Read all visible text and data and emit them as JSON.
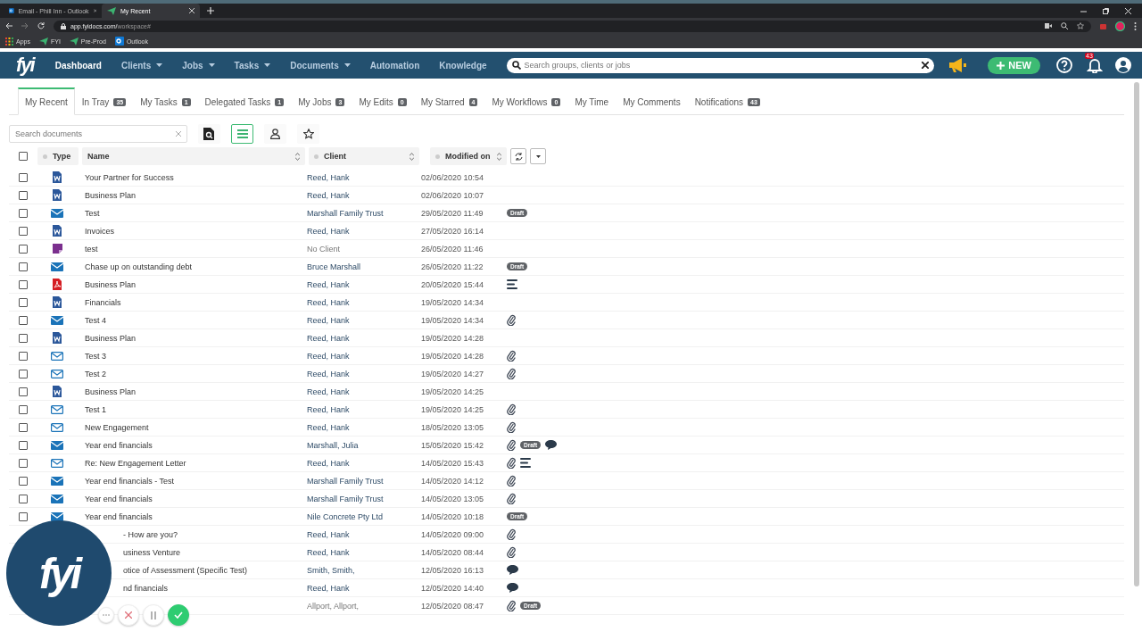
{
  "browser": {
    "tabs": [
      {
        "title": "Email - Phill Inn - Outlook",
        "selected": false,
        "kind": "outlook"
      },
      {
        "title": "My Recent",
        "selected": true,
        "kind": "fyi"
      }
    ],
    "url_host": "app.fyidocs.com/",
    "url_path": "workspace#",
    "bookmarks": [
      {
        "label": "Apps",
        "kind": "apps"
      },
      {
        "label": "FYI",
        "kind": "fyi"
      },
      {
        "label": "Pre-Prod",
        "kind": "fyi"
      },
      {
        "label": "Outlook",
        "kind": "outlook"
      }
    ]
  },
  "app": {
    "logo": "fyi",
    "nav": [
      {
        "label": "Dashboard",
        "selected": true,
        "dropdown": false
      },
      {
        "label": "Clients",
        "selected": false,
        "dropdown": true
      },
      {
        "label": "Jobs",
        "selected": false,
        "dropdown": true
      },
      {
        "label": "Tasks",
        "selected": false,
        "dropdown": true
      },
      {
        "label": "Documents",
        "selected": false,
        "dropdown": true
      },
      {
        "label": "Automation",
        "selected": false,
        "dropdown": false
      },
      {
        "label": "Knowledge",
        "selected": false,
        "dropdown": false
      }
    ],
    "search": {
      "placeholder": "Search groups, clients or jobs"
    },
    "new_button": "NEW",
    "notification_count": "43"
  },
  "tabs": [
    {
      "label": "My Recent",
      "selected": true
    },
    {
      "label": "In Tray",
      "count": "35",
      "selected": false
    },
    {
      "label": "My Tasks",
      "count": "1",
      "selected": false
    },
    {
      "label": "Delegated Tasks",
      "count": "1",
      "selected": false
    },
    {
      "label": "My Jobs",
      "count": "3",
      "selected": false
    },
    {
      "label": "My Edits",
      "count": "0",
      "selected": false
    },
    {
      "label": "My Starred",
      "count": "4",
      "selected": false
    },
    {
      "label": "My Workflows",
      "count": "0",
      "selected": false
    },
    {
      "label": "My Time",
      "selected": false
    },
    {
      "label": "My Comments",
      "selected": false
    },
    {
      "label": "Notifications",
      "count": "43",
      "selected": false
    }
  ],
  "toolbar": {
    "search_placeholder": "Search documents",
    "views": [
      {
        "kind": "preview",
        "selected": false
      },
      {
        "kind": "list",
        "selected": true
      },
      {
        "kind": "person",
        "selected": false
      },
      {
        "kind": "star",
        "selected": false
      }
    ]
  },
  "table": {
    "select_all_checked": false,
    "columns": [
      "Type",
      "Name",
      "Client",
      "Modified on"
    ],
    "rows": [
      {
        "kind": "word",
        "checked": false,
        "name": "Your Partner for Success",
        "client": "Reed, Hank",
        "linked": true,
        "modified": "02/06/2020 10:54",
        "marks": []
      },
      {
        "kind": "word",
        "checked": false,
        "name": "Business Plan",
        "client": "Reed, Hank",
        "linked": true,
        "modified": "02/06/2020 10:07",
        "marks": []
      },
      {
        "kind": "email",
        "checked": false,
        "name": "Test",
        "client": "Marshall Family Trust",
        "linked": true,
        "modified": "29/05/2020 11:49",
        "marks": [
          {
            "kind": "badge",
            "label": "Draft"
          }
        ]
      },
      {
        "kind": "word",
        "checked": false,
        "name": "Invoices",
        "client": "Reed, Hank",
        "linked": true,
        "modified": "27/05/2020 16:14",
        "marks": []
      },
      {
        "kind": "note",
        "checked": false,
        "name": "test",
        "client": "No Client",
        "linked": false,
        "modified": "26/05/2020 11:46",
        "marks": []
      },
      {
        "kind": "email",
        "checked": false,
        "name": "Chase up on outstanding debt",
        "client": "Bruce Marshall",
        "linked": true,
        "modified": "26/05/2020 11:22",
        "marks": [
          {
            "kind": "badge",
            "label": "Draft"
          }
        ]
      },
      {
        "kind": "pdf",
        "checked": false,
        "name": "Business Plan",
        "client": "Reed, Hank",
        "linked": true,
        "modified": "20/05/2020 15:44",
        "marks": [
          {
            "kind": "notes"
          }
        ]
      },
      {
        "kind": "word",
        "checked": false,
        "name": "Financials",
        "client": "Reed, Hank",
        "linked": true,
        "modified": "19/05/2020 14:34",
        "marks": []
      },
      {
        "kind": "email",
        "checked": false,
        "name": "Test 4",
        "client": "Reed, Hank",
        "linked": true,
        "modified": "19/05/2020 14:34",
        "marks": [
          {
            "kind": "attachment"
          }
        ]
      },
      {
        "kind": "word",
        "checked": false,
        "name": "Business Plan",
        "client": "Reed, Hank",
        "linked": true,
        "modified": "19/05/2020 14:28",
        "marks": []
      },
      {
        "kind": "email-outline",
        "checked": false,
        "name": "Test 3",
        "client": "Reed, Hank",
        "linked": true,
        "modified": "19/05/2020 14:28",
        "marks": [
          {
            "kind": "attachment"
          }
        ]
      },
      {
        "kind": "email-outline",
        "checked": false,
        "name": "Test 2",
        "client": "Reed, Hank",
        "linked": true,
        "modified": "19/05/2020 14:27",
        "marks": [
          {
            "kind": "attachment"
          }
        ]
      },
      {
        "kind": "word",
        "checked": false,
        "name": "Business Plan",
        "client": "Reed, Hank",
        "linked": true,
        "modified": "19/05/2020 14:25",
        "marks": []
      },
      {
        "kind": "email-outline",
        "checked": false,
        "name": "Test 1",
        "client": "Reed, Hank",
        "linked": true,
        "modified": "19/05/2020 14:25",
        "marks": [
          {
            "kind": "attachment"
          }
        ]
      },
      {
        "kind": "email-outline",
        "checked": false,
        "name": "New Engagement",
        "client": "Reed, Hank",
        "linked": true,
        "modified": "18/05/2020 13:05",
        "marks": [
          {
            "kind": "attachment"
          }
        ]
      },
      {
        "kind": "email",
        "checked": false,
        "name": "Year end financials",
        "client": "Marshall, Julia",
        "linked": true,
        "modified": "15/05/2020 15:42",
        "marks": [
          {
            "kind": "attachment"
          },
          {
            "kind": "badge",
            "label": "Draft"
          },
          {
            "kind": "comment"
          }
        ]
      },
      {
        "kind": "email-outline",
        "checked": false,
        "name": "Re: New Engagement Letter",
        "client": "Reed, Hank",
        "linked": true,
        "modified": "14/05/2020 15:43",
        "marks": [
          {
            "kind": "attachment"
          },
          {
            "kind": "notes"
          }
        ]
      },
      {
        "kind": "email",
        "checked": false,
        "name": "Year end financials - Test",
        "client": "Marshall Family Trust",
        "linked": true,
        "modified": "14/05/2020 14:12",
        "marks": [
          {
            "kind": "attachment"
          }
        ]
      },
      {
        "kind": "email",
        "checked": false,
        "name": "Year end financials",
        "client": "Marshall Family Trust",
        "linked": true,
        "modified": "14/05/2020 13:05",
        "marks": [
          {
            "kind": "attachment"
          }
        ]
      },
      {
        "kind": "email",
        "checked": false,
        "name": "Year end financials",
        "client": "Nile Concrete Pty Ltd",
        "linked": true,
        "modified": "14/05/2020 10:18",
        "marks": [
          {
            "kind": "badge",
            "label": "Draft"
          }
        ]
      },
      {
        "name": "- How are you?",
        "client": "Reed, Hank",
        "linked": true,
        "modified": "14/05/2020 09:00",
        "marks": [
          {
            "kind": "attachment"
          }
        ]
      },
      {
        "name": "usiness Venture",
        "client": "Reed, Hank",
        "linked": true,
        "modified": "14/05/2020 08:44",
        "marks": [
          {
            "kind": "attachment"
          }
        ]
      },
      {
        "name": "otice of Assessment (Specific Test)",
        "client": "Smith, Smith,",
        "linked": true,
        "modified": "12/05/2020 16:13",
        "marks": [
          {
            "kind": "comment"
          }
        ]
      },
      {
        "name": "nd financials",
        "client": "Reed, Hank",
        "linked": true,
        "modified": "12/05/2020 14:40",
        "marks": [
          {
            "kind": "comment"
          }
        ]
      },
      {
        "client": "Allport, Allport,",
        "linked": false,
        "modified": "12/05/2020 08:47",
        "marks": [
          {
            "kind": "attachment"
          },
          {
            "kind": "badge",
            "label": "Draft"
          }
        ]
      }
    ]
  },
  "recorder": {
    "logo": "fyi"
  }
}
